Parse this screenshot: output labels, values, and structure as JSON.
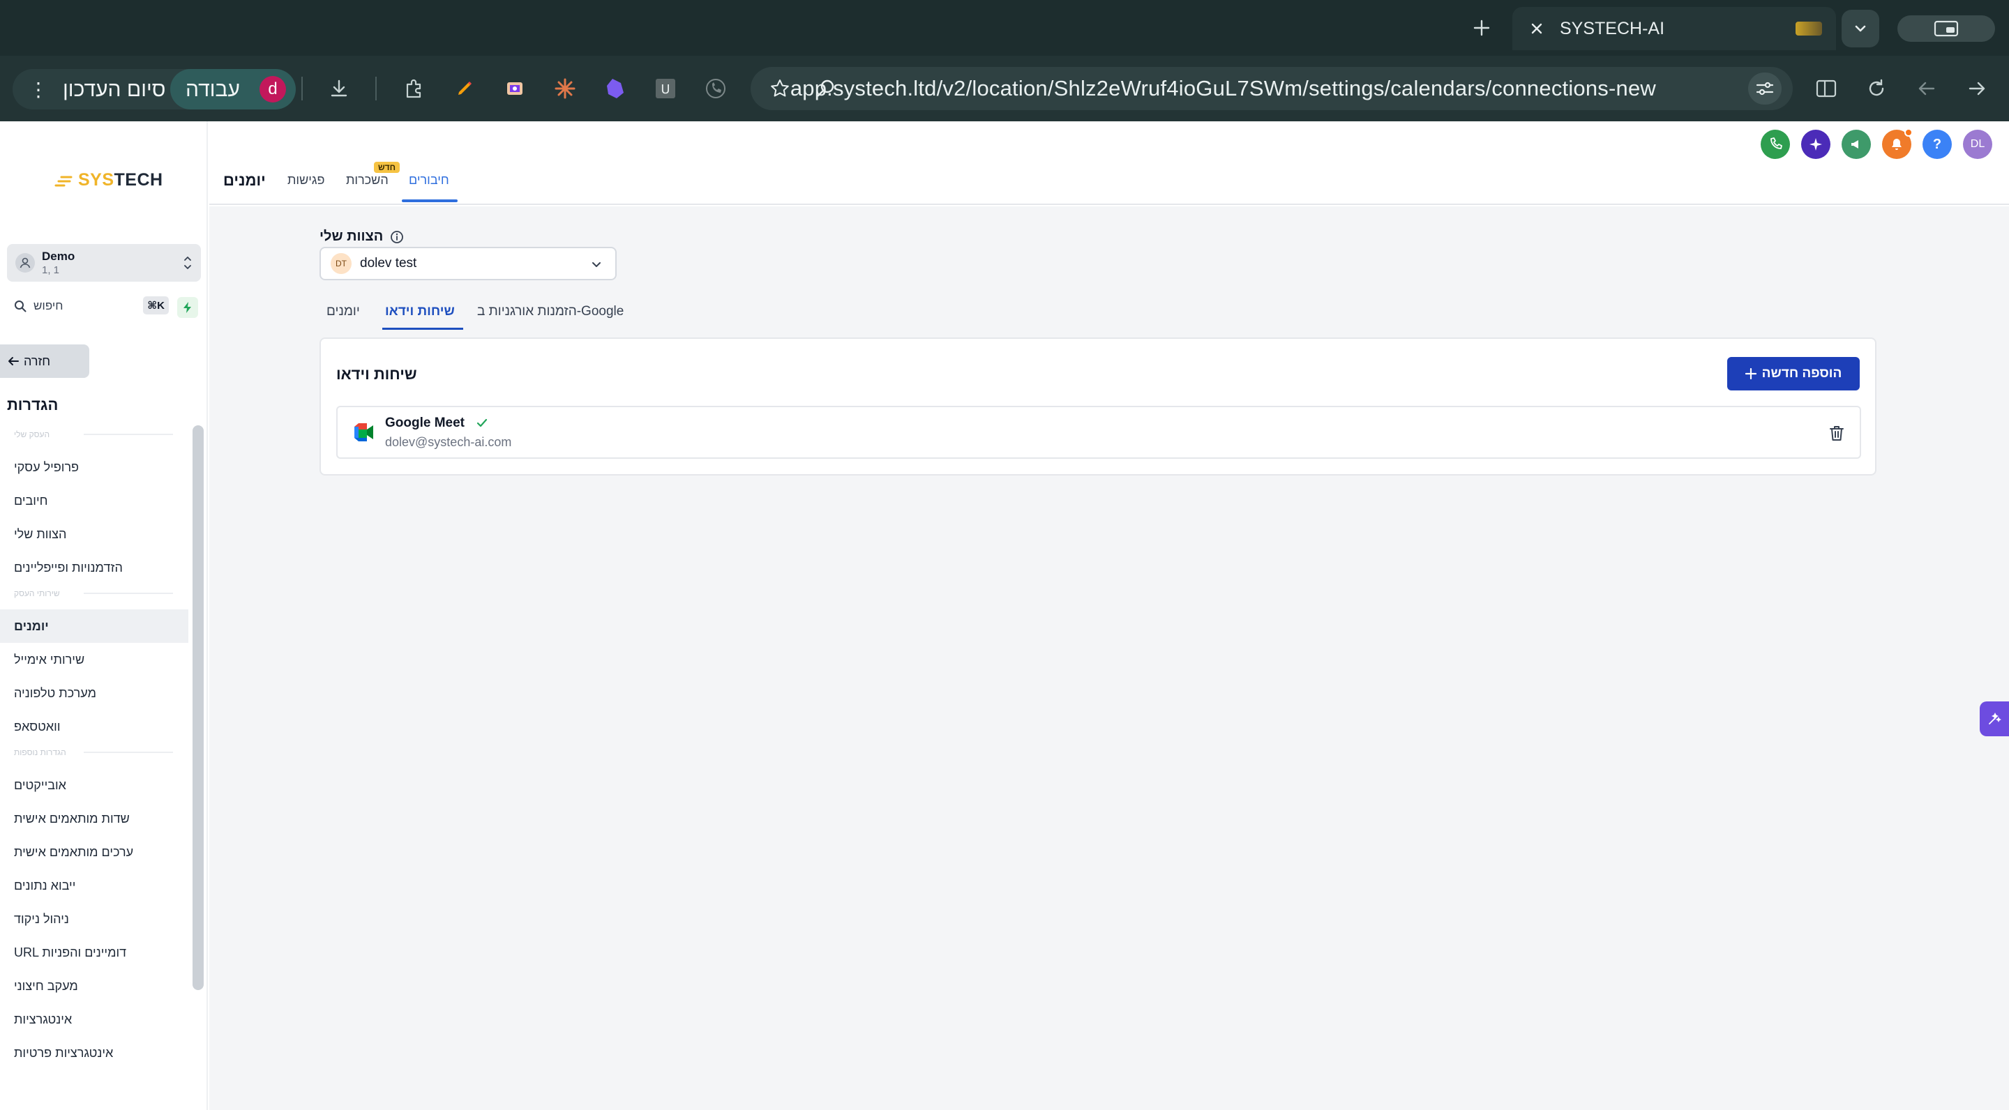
{
  "browser": {
    "tab_title": "SYSTECH-AI",
    "url": "app.systech.ltd/v2/location/Shlz2eWruf4ioGuL7SWm/settings/calendars/connections-new",
    "work_profile": {
      "finish_label": "סיום העדכון",
      "work_label": "עבודה",
      "avatar_letter": "d"
    }
  },
  "logo": {
    "part1": "SYS",
    "part2": "TECH"
  },
  "account": {
    "name": "Demo",
    "sub": "1, 1"
  },
  "search": {
    "placeholder": "חיפוש",
    "shortcut": "⌘K"
  },
  "sidebar": {
    "back_label": "חזרה",
    "settings_title": "הגדרות",
    "sections": [
      {
        "label": "העסק שלי",
        "items": [
          "פרופיל עסקי",
          "חיובים",
          "הצוות שלי",
          "הזדמנויות ופייפליינים"
        ]
      },
      {
        "label": "שירותי העסק",
        "items": [
          "יומנים",
          "שירותי אימייל",
          "מערכת טלפוניה",
          "וואטסאפ"
        ]
      },
      {
        "label": "הגדרות נוספות",
        "items": [
          "אובייקטים",
          "שדות מותאמים אישית",
          "ערכים מותאמים אישית",
          "ייבוא נתונים",
          "ניהול ניקוד",
          "URL דומיינים והפניות",
          "מעקב חיצוני",
          "אינטגרציות",
          "אינטגרציות פרטיות"
        ]
      }
    ],
    "active_item": "יומנים"
  },
  "header": {
    "page_title": "יומנים",
    "tabs": [
      {
        "label": "חיבורים",
        "active": true
      },
      {
        "label": "השכרות",
        "badge": "חדש"
      },
      {
        "label": "פגישות"
      }
    ],
    "user_initials": "DL"
  },
  "content": {
    "team_label": "הצוות שלי",
    "team_select": {
      "initials": "DT",
      "value": "dolev test"
    },
    "sub_tabs": [
      {
        "label": "יומנים"
      },
      {
        "label": "שיחות וידאו",
        "active": true
      },
      {
        "label": "הזמנות אורגניות ב-Google"
      }
    ],
    "card": {
      "title": "שיחות וידאו",
      "add_button": "הוספה חדשה",
      "connections": [
        {
          "name": "Google Meet",
          "email": "dolev@systech-ai.com",
          "verified": true
        }
      ]
    }
  },
  "colors": {
    "primary": "#1d3fb8",
    "tab_active": "#2f6fde",
    "header_call": "#2e9e4f",
    "header_ai": "#4b2bb8",
    "header_announce": "#3e9a6a",
    "header_notify": "#f07b2a",
    "header_help": "#3b82f6",
    "header_avatar": "#9b7ad1"
  }
}
